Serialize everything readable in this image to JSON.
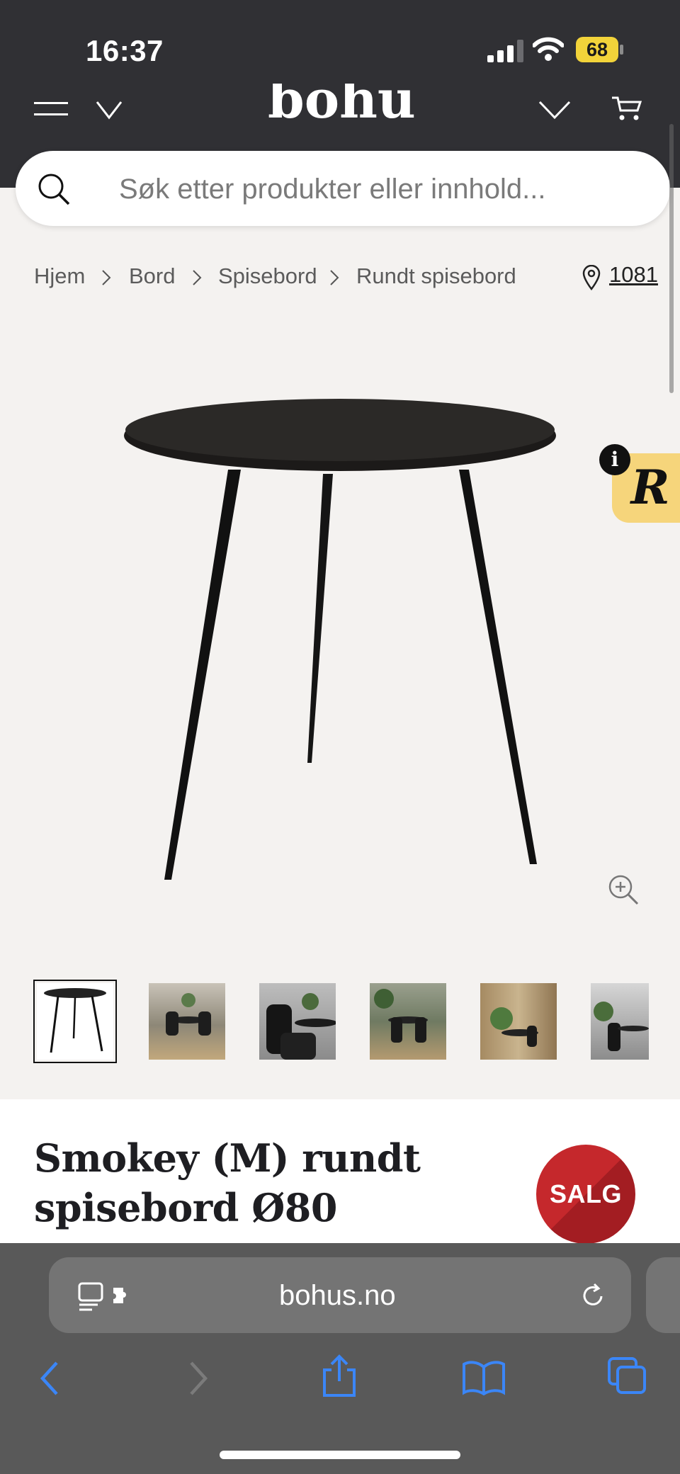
{
  "status_bar": {
    "time": "16:37",
    "battery": "68"
  },
  "header": {
    "logo": "bohus"
  },
  "search": {
    "placeholder": "Søk etter produkter eller innhold..."
  },
  "breadcrumb": {
    "items": [
      "Hjem",
      "Bord",
      "Spisebord",
      "Rundt spisebord"
    ]
  },
  "postal_code": "1081",
  "review_widget": {
    "letter": "R",
    "info": "i"
  },
  "product": {
    "title_line1": "Smokey (M) rundt",
    "title_line2": "spisebord Ø80",
    "badge": "SALG"
  },
  "gallery": {
    "thumbnail_count": 6,
    "selected_index": 0
  },
  "browser": {
    "url": "bohus.no"
  },
  "colors": {
    "header_bg": "#303034",
    "page_bg": "#f4f2f0",
    "sale_red": "#c5282c",
    "review_yellow": "#f6d57b",
    "battery_yellow": "#f2d33a",
    "safari_blue": "#3b86f7"
  }
}
